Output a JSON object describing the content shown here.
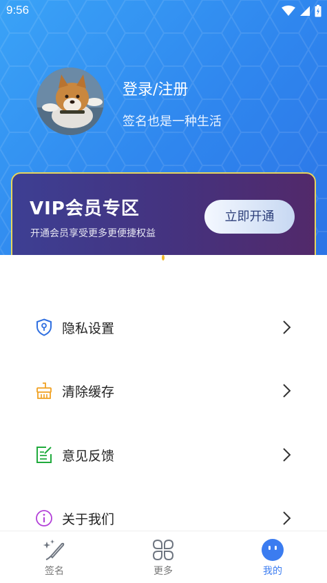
{
  "status_bar": {
    "time": "9:56"
  },
  "profile": {
    "login_label": "登录/注册",
    "signature": "签名也是一种生活"
  },
  "vip": {
    "title": "VIP会员专区",
    "subtitle": "开通会员享受更多更便捷权益",
    "button_label": "立即开通"
  },
  "menu": {
    "items": [
      {
        "label": "隐私设置",
        "icon": "shield-lock-icon",
        "color": "#2f6fe0"
      },
      {
        "label": "清除缓存",
        "icon": "broom-icon",
        "color": "#f0a020"
      },
      {
        "label": "意见反馈",
        "icon": "feedback-edit-icon",
        "color": "#1faa3c"
      },
      {
        "label": "关于我们",
        "icon": "info-icon",
        "color": "#b23fd8"
      }
    ]
  },
  "bottom_nav": {
    "items": [
      {
        "label": "签名",
        "icon": "signature-pen-icon",
        "active": false
      },
      {
        "label": "更多",
        "icon": "grid-more-icon",
        "active": false
      },
      {
        "label": "我的",
        "icon": "profile-face-icon",
        "active": true
      }
    ]
  },
  "colors": {
    "header_blue": "#2f86ee",
    "vip_border": "#e8d65c",
    "active_tab": "#3b7cf0"
  }
}
